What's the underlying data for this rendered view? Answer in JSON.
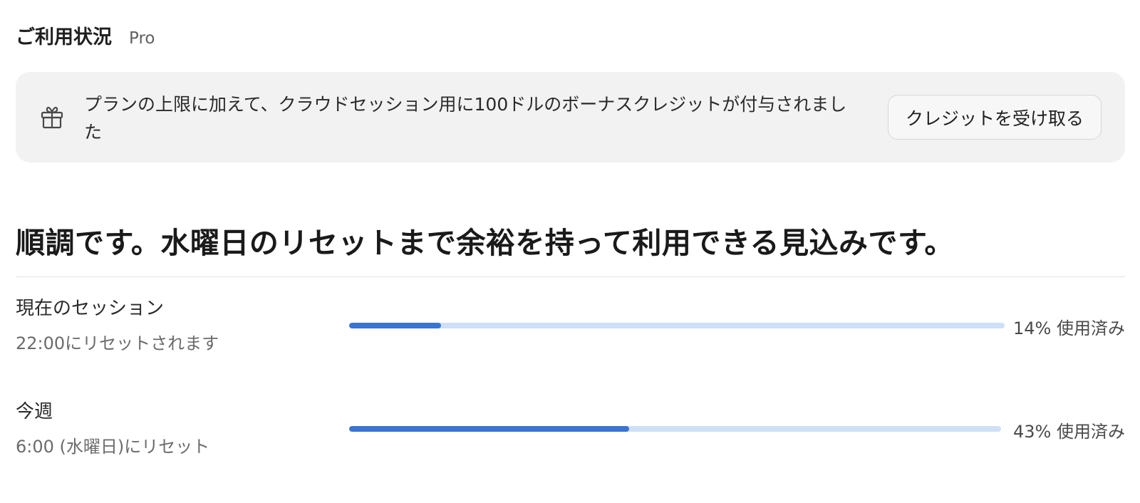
{
  "header": {
    "title": "ご利用状況",
    "plan": "Pro"
  },
  "banner": {
    "icon": "gift-icon",
    "text": "プランの上限に加えて、クラウドセッション用に100ドルのボーナスクレジットが付与されました",
    "button_label": "クレジットを受け取る"
  },
  "status": {
    "headline": "順調です。水曜日のリセットまで余裕を持って利用できる見込みです。"
  },
  "usage": [
    {
      "title": "現在のセッション",
      "reset": "22:00にリセットされます",
      "percent": 14,
      "percent_label": "14% 使用済み"
    },
    {
      "title": "今週",
      "reset": "6:00 (水曜日)にリセット",
      "percent": 43,
      "percent_label": "43% 使用済み"
    }
  ],
  "colors": {
    "bar_fill": "#3b74d1",
    "bar_track": "#cfe0f6",
    "banner_bg": "#f2f2f2"
  }
}
